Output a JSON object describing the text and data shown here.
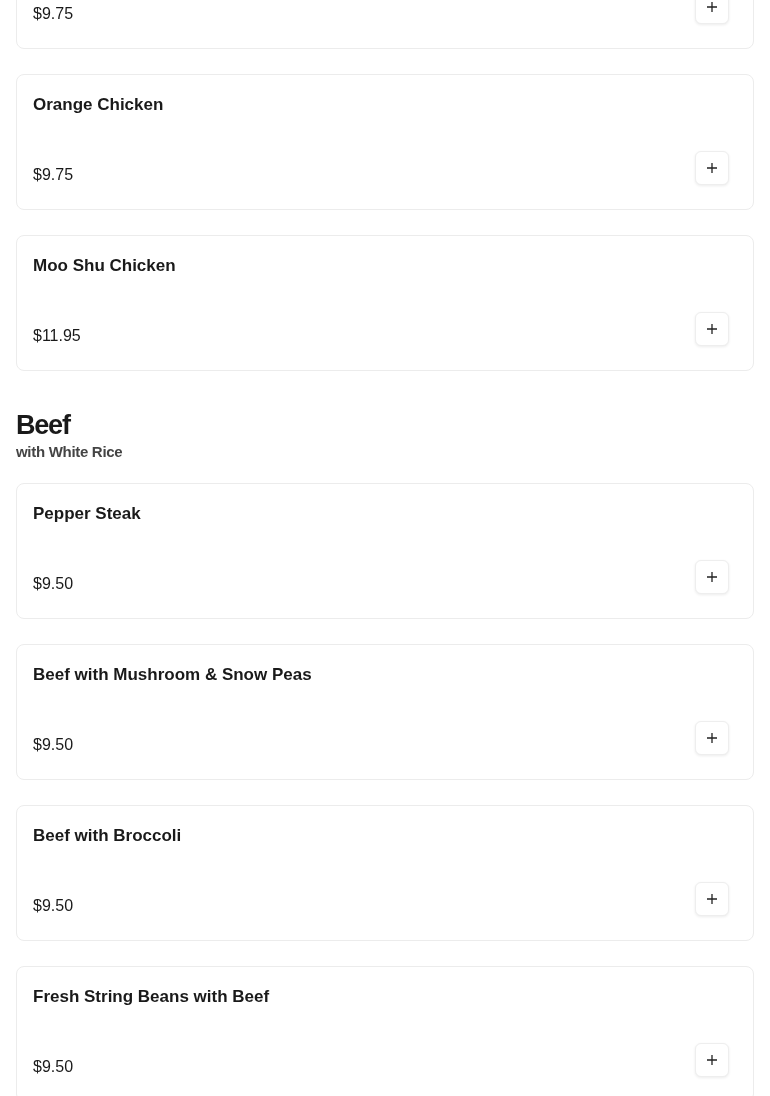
{
  "sections": [
    {
      "items": [
        {
          "price": "$9.75"
        },
        {
          "name": "Orange Chicken",
          "price": "$9.75"
        },
        {
          "name": "Moo Shu Chicken",
          "price": "$11.95"
        }
      ]
    },
    {
      "title": "Beef",
      "subtitle": "with White Rice",
      "items": [
        {
          "name": "Pepper Steak",
          "price": "$9.50"
        },
        {
          "name": "Beef with Mushroom & Snow Peas",
          "price": "$9.50"
        },
        {
          "name": "Beef with Broccoli",
          "price": "$9.50"
        },
        {
          "name": "Fresh String Beans with Beef",
          "price": "$9.50"
        }
      ]
    }
  ]
}
